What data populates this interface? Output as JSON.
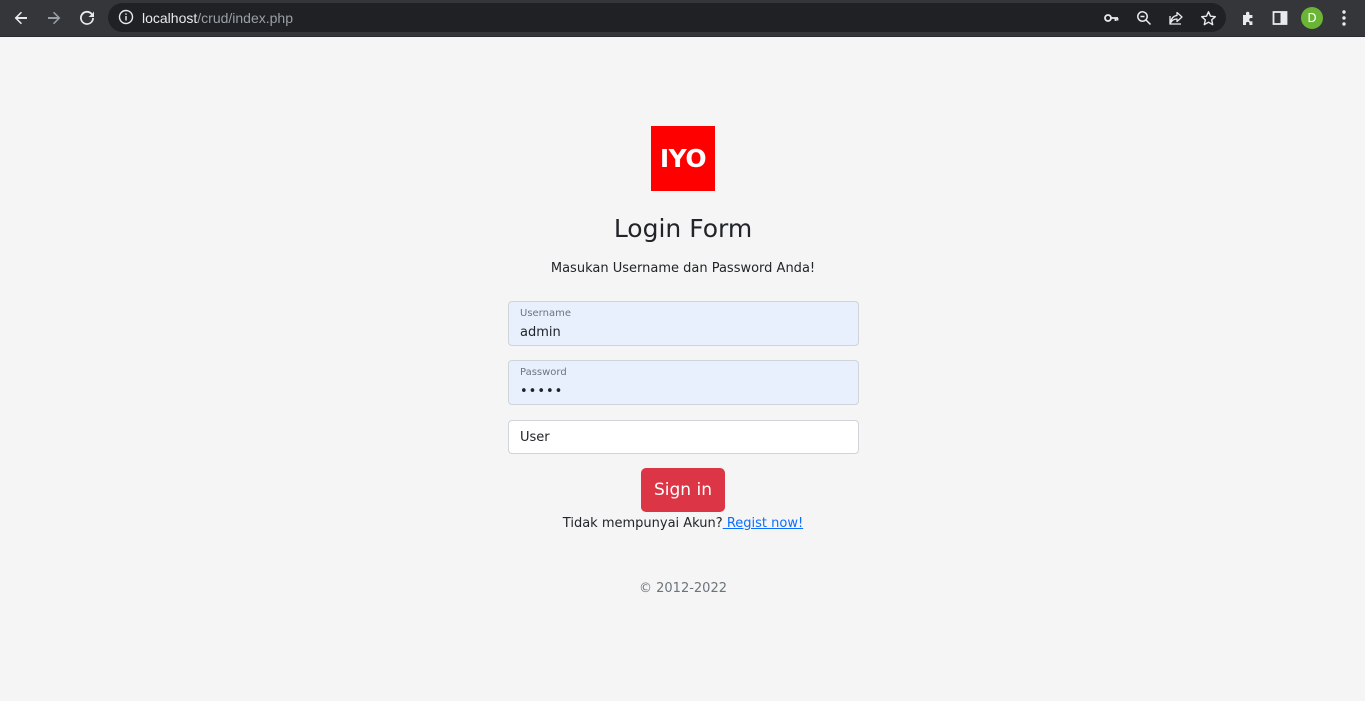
{
  "browser": {
    "url_host": "localhost",
    "url_path": "/crud/index.php",
    "avatar_initial": "D",
    "avatar_color": "#6bb536",
    "icons": [
      "back-icon",
      "forward-icon",
      "reload-icon",
      "info-icon",
      "key-icon",
      "zoom-icon",
      "share-icon",
      "star-icon",
      "extensions-icon",
      "side-panel-icon",
      "menu-icon"
    ]
  },
  "page": {
    "logo_text": "IYO",
    "logo_color": "#fe0000",
    "title": "Login Form",
    "subtitle": "Masukan Username dan Password Anda!",
    "username_label": "Username",
    "username_value": "admin",
    "password_label": "Password",
    "password_value": "•••••",
    "role_value": "User",
    "signin_label": "Sign in",
    "signin_color": "#dc3545",
    "no_account_text": "Tidak mempunyai Akun?",
    "regist_link": " Regist now!",
    "copyright": "© 2012-2022"
  }
}
